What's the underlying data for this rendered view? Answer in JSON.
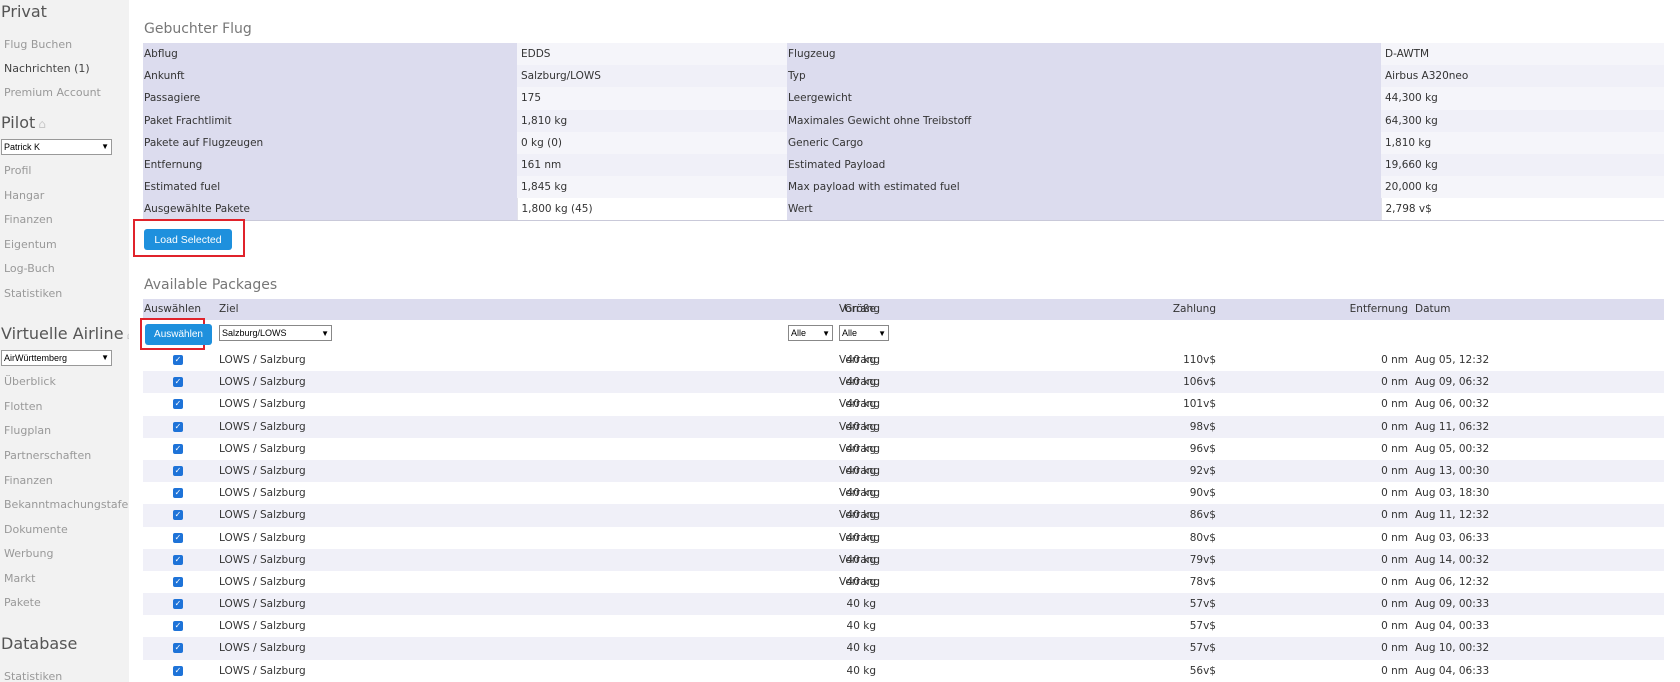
{
  "sidebar": {
    "privat": {
      "heading": "Privat",
      "items": [
        "Flug Buchen",
        "Nachrichten (1)",
        "Premium Account"
      ]
    },
    "pilot": {
      "heading": "Pilot",
      "selected": "Patrick K",
      "items": [
        "Profil",
        "Hangar",
        "Finanzen",
        "Eigentum",
        "Log-Buch",
        "Statistiken"
      ]
    },
    "airline": {
      "heading": "Virtuelle Airline",
      "selected": "AirWürttemberg",
      "items": [
        "Überblick",
        "Flotten",
        "Flugplan",
        "Partnerschaften",
        "Finanzen",
        "Bekanntmachungstafel",
        "Dokumente",
        "Werbung",
        "Markt",
        "Pakete"
      ]
    },
    "database": {
      "heading": "Database",
      "items": [
        "Statistiken"
      ]
    }
  },
  "booked_flight": {
    "title": "Gebuchter Flug",
    "rows": [
      {
        "l1": "Abflug",
        "v1": "EDDS",
        "l2": "Flugzeug",
        "v2": "D-AWTM"
      },
      {
        "l1": "Ankunft",
        "v1": "Salzburg/LOWS",
        "l2": "Typ",
        "v2": "Airbus A320neo"
      },
      {
        "l1": "Passagiere",
        "v1": "175",
        "l2": "Leergewicht",
        "v2": "44,300 kg"
      },
      {
        "l1": "Paket Frachtlimit",
        "v1": "1,810 kg",
        "l2": "Maximales Gewicht ohne Treibstoff",
        "v2": "64,300 kg"
      },
      {
        "l1": "Pakete auf Flugzeugen",
        "v1": "0 kg (0)",
        "l2": "Generic Cargo",
        "v2": "1,810 kg"
      },
      {
        "l1": "Entfernung",
        "v1": "161 nm",
        "l2": "Estimated Payload",
        "v2": "19,660 kg"
      },
      {
        "l1": "Estimated fuel",
        "v1": "1,845 kg",
        "l2": "Max payload with estimated fuel",
        "v2": "20,000 kg"
      },
      {
        "l1": "Ausgewählte Pakete",
        "v1": "1,800 kg (45)",
        "l2": "Wert",
        "v2": "2,798 v$"
      }
    ],
    "load_button": "Load Selected"
  },
  "packages": {
    "title": "Available Packages",
    "headers": {
      "select": "Auswählen",
      "dest": "Ziel",
      "size": "Größe",
      "priority": "Vorrang",
      "payment": "Zahlung",
      "distance": "Entfernung",
      "date": "Datum"
    },
    "select_button": "Auswählen",
    "filter_dest": "Salzburg/LOWS",
    "filter_size": "Alle",
    "filter_priority": "Alle",
    "rows": [
      {
        "dest": "LOWS / Salzburg",
        "size": "40 kg",
        "prio": "Vorrang",
        "pay": "110v$",
        "dist": "0 nm",
        "date": "Aug 05, 12:32"
      },
      {
        "dest": "LOWS / Salzburg",
        "size": "40 kg",
        "prio": "Vorrang",
        "pay": "106v$",
        "dist": "0 nm",
        "date": "Aug 09, 06:32"
      },
      {
        "dest": "LOWS / Salzburg",
        "size": "40 kg",
        "prio": "Vorrang",
        "pay": "101v$",
        "dist": "0 nm",
        "date": "Aug 06, 00:32"
      },
      {
        "dest": "LOWS / Salzburg",
        "size": "40 kg",
        "prio": "Vorrang",
        "pay": "98v$",
        "dist": "0 nm",
        "date": "Aug 11, 06:32"
      },
      {
        "dest": "LOWS / Salzburg",
        "size": "40 kg",
        "prio": "Vorrang",
        "pay": "96v$",
        "dist": "0 nm",
        "date": "Aug 05, 00:32"
      },
      {
        "dest": "LOWS / Salzburg",
        "size": "40 kg",
        "prio": "Vorrang",
        "pay": "92v$",
        "dist": "0 nm",
        "date": "Aug 13, 00:30"
      },
      {
        "dest": "LOWS / Salzburg",
        "size": "40 kg",
        "prio": "Vorrang",
        "pay": "90v$",
        "dist": "0 nm",
        "date": "Aug 03, 18:30"
      },
      {
        "dest": "LOWS / Salzburg",
        "size": "40 kg",
        "prio": "Vorrang",
        "pay": "86v$",
        "dist": "0 nm",
        "date": "Aug 11, 12:32"
      },
      {
        "dest": "LOWS / Salzburg",
        "size": "40 kg",
        "prio": "Vorrang",
        "pay": "80v$",
        "dist": "0 nm",
        "date": "Aug 03, 06:33"
      },
      {
        "dest": "LOWS / Salzburg",
        "size": "40 kg",
        "prio": "Vorrang",
        "pay": "79v$",
        "dist": "0 nm",
        "date": "Aug 14, 00:32"
      },
      {
        "dest": "LOWS / Salzburg",
        "size": "40 kg",
        "prio": "Vorrang",
        "pay": "78v$",
        "dist": "0 nm",
        "date": "Aug 06, 12:32"
      },
      {
        "dest": "LOWS / Salzburg",
        "size": "40 kg",
        "prio": "",
        "pay": "57v$",
        "dist": "0 nm",
        "date": "Aug 09, 00:33"
      },
      {
        "dest": "LOWS / Salzburg",
        "size": "40 kg",
        "prio": "",
        "pay": "57v$",
        "dist": "0 nm",
        "date": "Aug 04, 00:33"
      },
      {
        "dest": "LOWS / Salzburg",
        "size": "40 kg",
        "prio": "",
        "pay": "57v$",
        "dist": "0 nm",
        "date": "Aug 10, 00:32"
      },
      {
        "dest": "LOWS / Salzburg",
        "size": "40 kg",
        "prio": "",
        "pay": "56v$",
        "dist": "0 nm",
        "date": "Aug 04, 06:33"
      }
    ]
  },
  "icons": {
    "home": "home-icon",
    "check": "checkbox-checked-icon",
    "dropdown": "chevron-down-icon"
  }
}
